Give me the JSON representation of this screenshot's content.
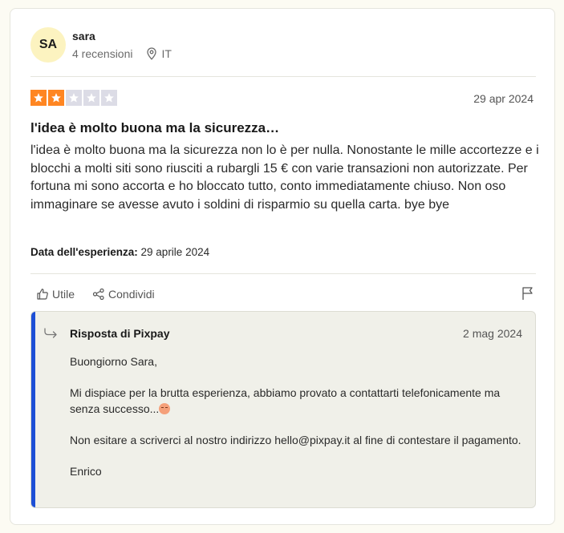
{
  "consumer": {
    "initials": "SA",
    "name": "sara",
    "reviews_count": "4 recensioni",
    "country": "IT"
  },
  "review": {
    "rating": 2,
    "max_rating": 5,
    "date": "29 apr 2024",
    "title": "l'idea è molto buona ma la sicurezza…",
    "body": "l'idea è molto buona ma la sicurezza non lo è per nulla. Nonostante le mille accortezze e i blocchi a molti siti sono riusciti a rubargli 15 € con varie transazioni non autorizzate. Per fortuna mi sono accorta e ho bloccato tutto, conto immediatamente chiuso. Non oso immaginare se avesse avuto i soldini di risparmio su quella carta. bye bye",
    "experience_label": "Data dell'esperienza:",
    "experience_date": "29 aprile 2024"
  },
  "actions": {
    "useful": "Utile",
    "share": "Condividi"
  },
  "reply": {
    "title": "Risposta di Pixpay",
    "date": "2 mag 2024",
    "greeting": "Buongiorno Sara,",
    "paragraph1": "Mi dispiace per la brutta esperienza, abbiamo provato a contattarti telefonicamente ma senza successo...",
    "paragraph2": "Non esitare a scriverci al nostro indirizzo hello@pixpay.it al fine di contestare il pagamento.",
    "signature": "Enrico"
  },
  "colors": {
    "star_on": "#ff8622",
    "star_off": "#dcdce6",
    "reply_accent": "#1d4fd6",
    "avatar_bg": "#fcf3c0"
  }
}
